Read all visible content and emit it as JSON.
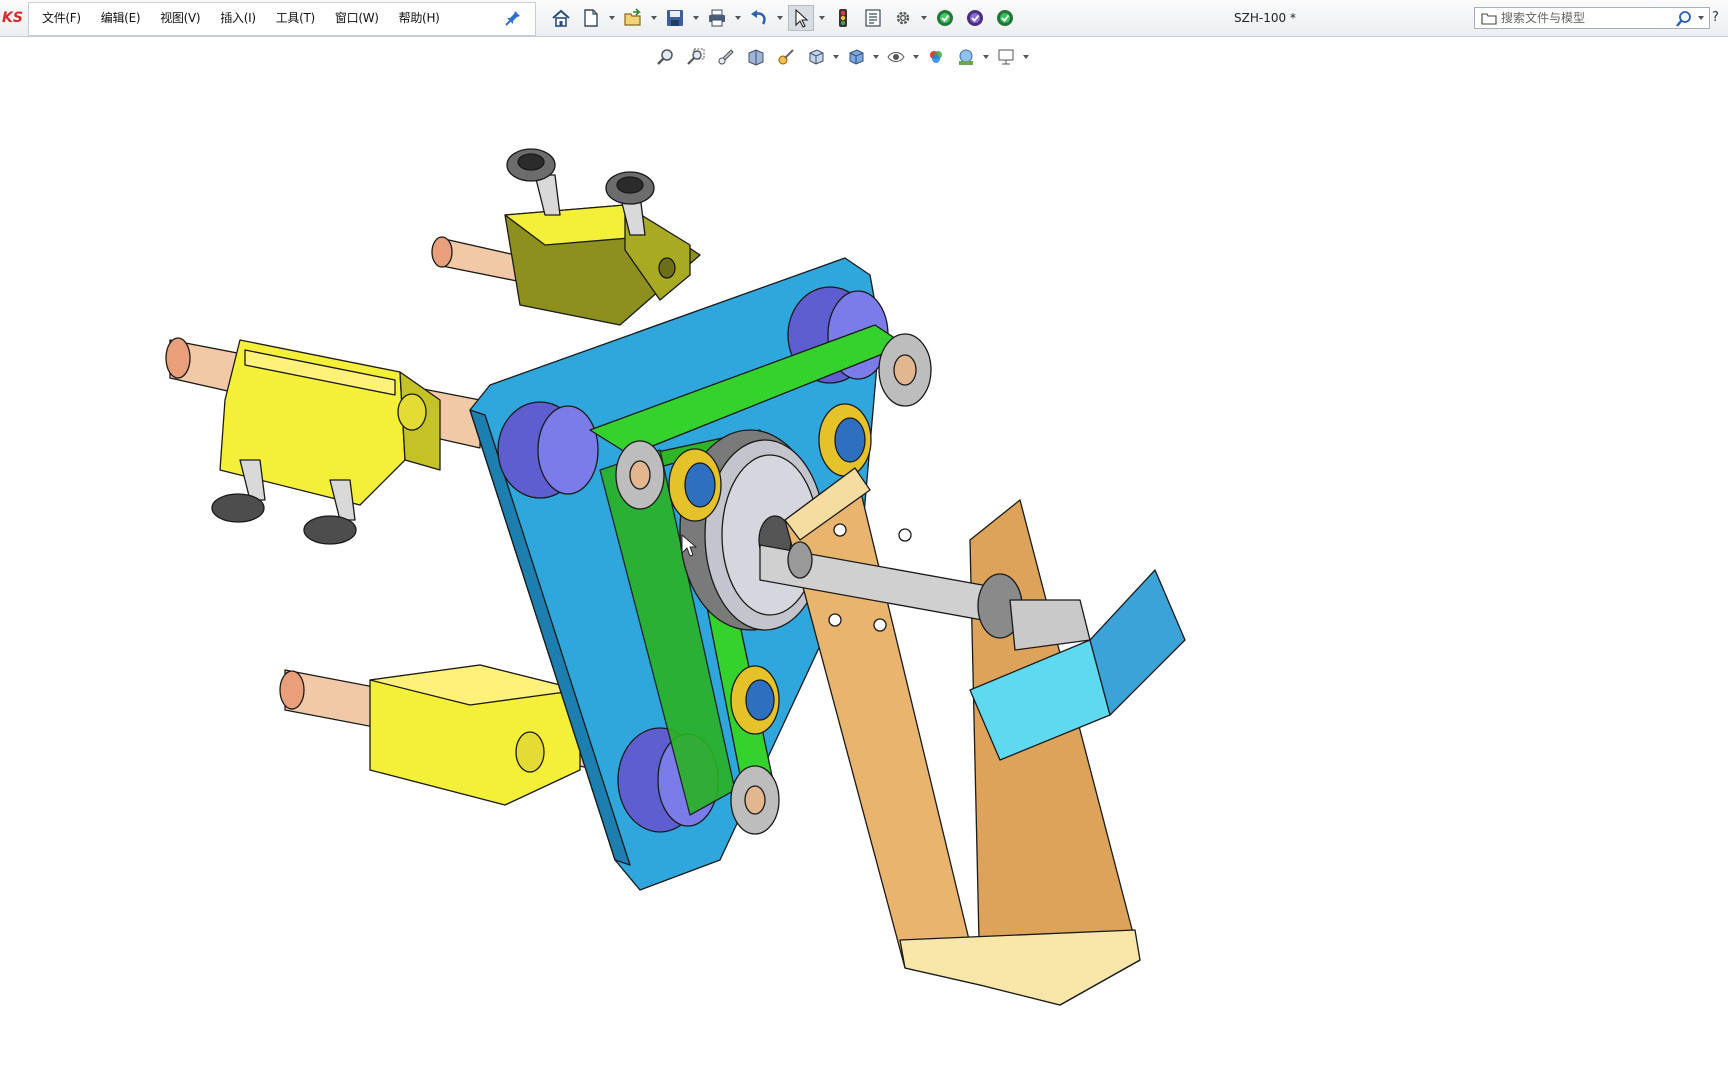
{
  "app": {
    "logo_text": "KS",
    "document_title": "SZH-100 *"
  },
  "menu": {
    "items": [
      {
        "label": "文件(F)",
        "name": "menu-file"
      },
      {
        "label": "编辑(E)",
        "name": "menu-edit"
      },
      {
        "label": "视图(V)",
        "name": "menu-view"
      },
      {
        "label": "插入(I)",
        "name": "menu-insert"
      },
      {
        "label": "工具(T)",
        "name": "menu-tools"
      },
      {
        "label": "窗口(W)",
        "name": "menu-window"
      },
      {
        "label": "帮助(H)",
        "name": "menu-help"
      }
    ]
  },
  "toolbar": {
    "icons": [
      "home-icon",
      "new-document-icon",
      "open-folder-icon",
      "save-icon",
      "print-icon",
      "undo-icon",
      "select-arrow-icon",
      "traffic-light-icon",
      "properties-icon",
      "options-gear-icon",
      "rebuild-icon",
      "rebuild-purple-icon",
      "rebuild-green-icon"
    ]
  },
  "heads_up_toolbar": {
    "icons": [
      "zoom-to-fit-icon",
      "zoom-to-area-icon",
      "previous-view-icon",
      "section-view-icon",
      "dynamic-annotation-icon",
      "view-orientation-icon",
      "display-style-icon",
      "hide-show-icon",
      "edit-appearance-icon",
      "apply-scene-icon",
      "view-settings-icon"
    ]
  },
  "search": {
    "placeholder": "搜索文件与模型"
  },
  "colors": {
    "plate_blue": "#2fa6dc",
    "belt_green": "#35d12c",
    "bracket_tan": "#e8b46e",
    "block_yellow": "#f4f03a",
    "block_olive": "#8d8f1e",
    "pulley_purple": "#6f6fe0",
    "bearing_gold": "#e6c22a",
    "tray_cyan": "#5fd9f0"
  }
}
